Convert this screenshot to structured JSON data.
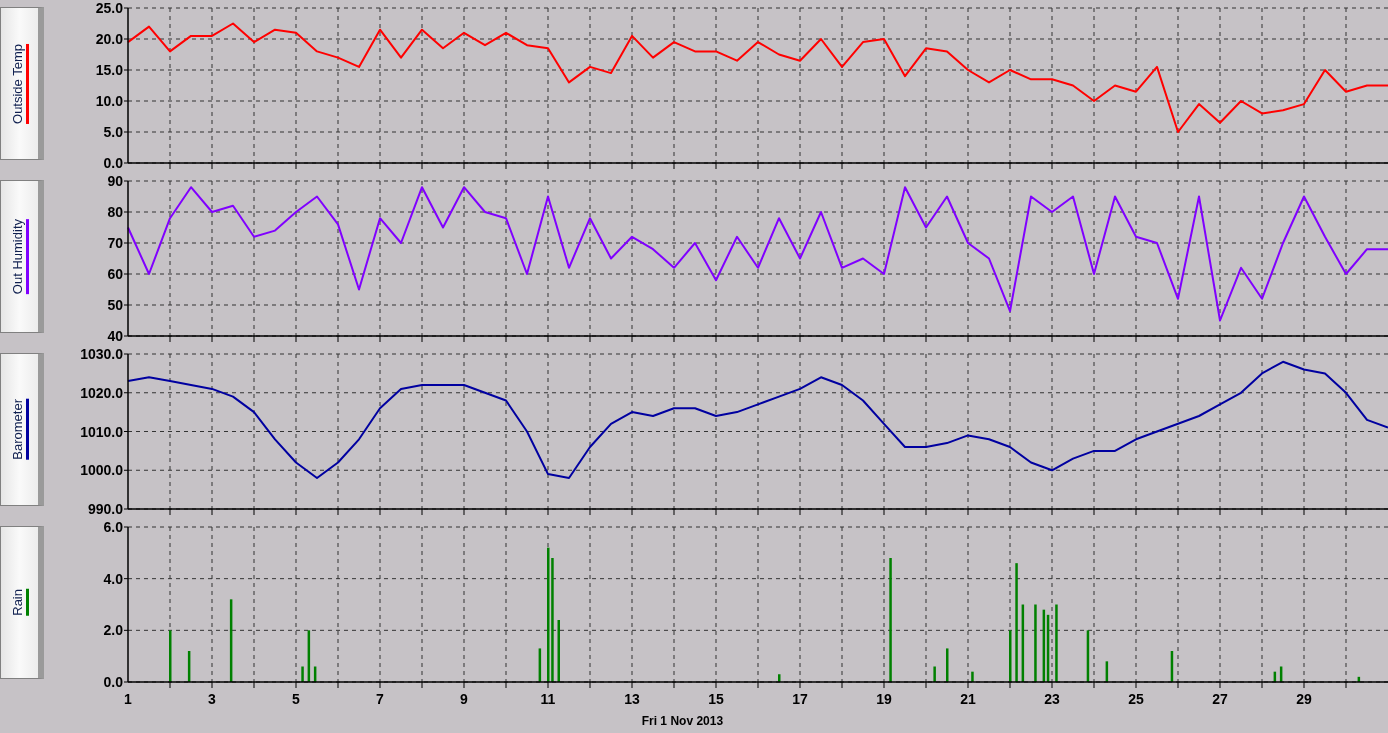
{
  "panels": [
    {
      "chart_data": {
        "type": "line",
        "grid": true,
        "x": [
          1,
          1.5,
          2,
          2.5,
          3,
          3.5,
          4,
          4.5,
          5,
          5.5,
          6,
          6.5,
          7,
          7.5,
          8,
          8.5,
          9,
          9.5,
          10,
          10.5,
          11,
          11.5,
          12,
          12.5,
          13,
          13.5,
          14,
          14.5,
          15,
          15.5,
          16,
          16.5,
          17,
          17.5,
          18,
          18.5,
          19,
          19.5,
          20,
          20.5,
          21,
          21.5,
          22,
          22.5,
          23,
          23.5,
          24,
          24.5,
          25,
          25.5,
          26,
          26.5,
          27,
          27.5,
          28,
          28.5,
          29,
          29.5,
          30,
          30.5,
          31
        ],
        "ylim": [
          0,
          25
        ],
        "yticks": [
          {
            "value": 0,
            "label": "0.0"
          },
          {
            "value": 5,
            "label": "5.0"
          },
          {
            "value": 10,
            "label": "10.0"
          },
          {
            "value": 15,
            "label": "15.0"
          },
          {
            "value": 20,
            "label": "20.0"
          },
          {
            "value": 25,
            "label": "25.0"
          }
        ],
        "xlim": [
          1,
          31
        ],
        "series": [
          {
            "name": "Outside Temp",
            "color": "#ff0000",
            "values": [
              19.5,
              22,
              18,
              20.5,
              20.5,
              22.5,
              19.5,
              21.5,
              21,
              18,
              17,
              15.5,
              21.5,
              17,
              21.5,
              18.5,
              21,
              19,
              21,
              19,
              18.5,
              13,
              15.5,
              14.5,
              20.5,
              17,
              19.5,
              18,
              18,
              16.5,
              19.5,
              17.5,
              16.5,
              20,
              15.5,
              19.5,
              20,
              14,
              18.5,
              18,
              15,
              13,
              15,
              13.5,
              13.5,
              12.5,
              10,
              12.5,
              11.5,
              15.5,
              5,
              9.5,
              6.5,
              10,
              8,
              8.5,
              9.5,
              15,
              11.5,
              12.5,
              12.5
            ]
          }
        ]
      }
    },
    {
      "chart_data": {
        "type": "line",
        "grid": true,
        "x": [
          1,
          1.5,
          2,
          2.5,
          3,
          3.5,
          4,
          4.5,
          5,
          5.5,
          6,
          6.5,
          7,
          7.5,
          8,
          8.5,
          9,
          9.5,
          10,
          10.5,
          11,
          11.5,
          12,
          12.5,
          13,
          13.5,
          14,
          14.5,
          15,
          15.5,
          16,
          16.5,
          17,
          17.5,
          18,
          18.5,
          19,
          19.5,
          20,
          20.5,
          21,
          21.5,
          22,
          22.5,
          23,
          23.5,
          24,
          24.5,
          25,
          25.5,
          26,
          26.5,
          27,
          27.5,
          28,
          28.5,
          29,
          29.5,
          30,
          30.5,
          31
        ],
        "ylim": [
          40,
          90
        ],
        "yticks": [
          40,
          50,
          60,
          70,
          80,
          90
        ],
        "xlim": [
          1,
          31
        ],
        "series": [
          {
            "name": "Out Humidity",
            "color": "#8000ff",
            "values": [
              75,
              60,
              78,
              88,
              80,
              82,
              72,
              74,
              80,
              85,
              76,
              55,
              78,
              70,
              88,
              75,
              88,
              80,
              78,
              60,
              85,
              62,
              78,
              65,
              72,
              68,
              62,
              70,
              58,
              72,
              62,
              78,
              65,
              80,
              62,
              65,
              60,
              88,
              75,
              85,
              70,
              65,
              48,
              85,
              80,
              85,
              60,
              85,
              72,
              70,
              52,
              85,
              45,
              62,
              52,
              70,
              85,
              72,
              60,
              68,
              68
            ]
          }
        ]
      }
    },
    {
      "chart_data": {
        "type": "line",
        "grid": true,
        "x": [
          1,
          1.5,
          2,
          2.5,
          3,
          3.5,
          4,
          4.5,
          5,
          5.5,
          6,
          6.5,
          7,
          7.5,
          8,
          8.5,
          9,
          9.5,
          10,
          10.5,
          11,
          11.5,
          12,
          12.5,
          13,
          13.5,
          14,
          14.5,
          15,
          15.5,
          16,
          16.5,
          17,
          17.5,
          18,
          18.5,
          19,
          19.5,
          20,
          20.5,
          21,
          21.5,
          22,
          22.5,
          23,
          23.5,
          24,
          24.5,
          25,
          25.5,
          26,
          26.5,
          27,
          27.5,
          28,
          28.5,
          29,
          29.5,
          30,
          30.5,
          31
        ],
        "ylim": [
          990,
          1030
        ],
        "yticks": [
          {
            "value": 990,
            "label": "990.0"
          },
          {
            "value": 1000,
            "label": "1000.0"
          },
          {
            "value": 1010,
            "label": "1010.0"
          },
          {
            "value": 1020,
            "label": "1020.0"
          },
          {
            "value": 1030,
            "label": "1030.0"
          }
        ],
        "xlim": [
          1,
          31
        ],
        "series": [
          {
            "name": "Barometer",
            "color": "#0000a0",
            "values": [
              1023,
              1024,
              1023,
              1022,
              1021,
              1019,
              1015,
              1008,
              1002,
              998,
              1002,
              1008,
              1016,
              1021,
              1022,
              1022,
              1022,
              1020,
              1018,
              1010,
              999,
              998,
              1006,
              1012,
              1015,
              1014,
              1016,
              1016,
              1014,
              1015,
              1017,
              1019,
              1021,
              1024,
              1022,
              1018,
              1012,
              1006,
              1006,
              1007,
              1009,
              1008,
              1006,
              1002,
              1000,
              1003,
              1005,
              1005,
              1008,
              1010,
              1012,
              1014,
              1017,
              1020,
              1025,
              1028,
              1026,
              1025,
              1020,
              1013,
              1011
            ]
          }
        ]
      }
    },
    {
      "chart_data": {
        "type": "bar",
        "grid": true,
        "xlabel": "Fri 1 Nov 2013",
        "x": [
          2,
          2.45,
          3.45,
          5.15,
          5.3,
          5.45,
          10.8,
          11,
          11.1,
          11.25,
          16.5,
          19.15,
          20.2,
          20.5,
          21.1,
          22,
          22.15,
          22.3,
          22.6,
          22.8,
          22.9,
          23.1,
          23.85,
          24.3,
          25.85,
          28.3,
          28.45,
          30.3
        ],
        "ylim": [
          0,
          6
        ],
        "yticks": [
          {
            "value": 0,
            "label": "0.0"
          },
          {
            "value": 2,
            "label": "2.0"
          },
          {
            "value": 4,
            "label": "4.0"
          },
          {
            "value": 6,
            "label": "6.0"
          }
        ],
        "xlim": [
          1,
          31
        ],
        "xticks": [
          1,
          3,
          5,
          7,
          9,
          11,
          13,
          15,
          17,
          19,
          21,
          23,
          25,
          27,
          29
        ],
        "series": [
          {
            "name": "Rain",
            "color": "#008000",
            "values": [
              2.0,
              1.2,
              3.2,
              0.6,
              2.0,
              0.6,
              1.3,
              5.2,
              4.8,
              2.4,
              0.3,
              4.8,
              0.6,
              1.3,
              0.4,
              2.0,
              4.6,
              3.0,
              3.0,
              2.8,
              2.6,
              3.0,
              2.0,
              0.8,
              1.2,
              0.4,
              0.6,
              0.2
            ]
          }
        ]
      }
    }
  ]
}
